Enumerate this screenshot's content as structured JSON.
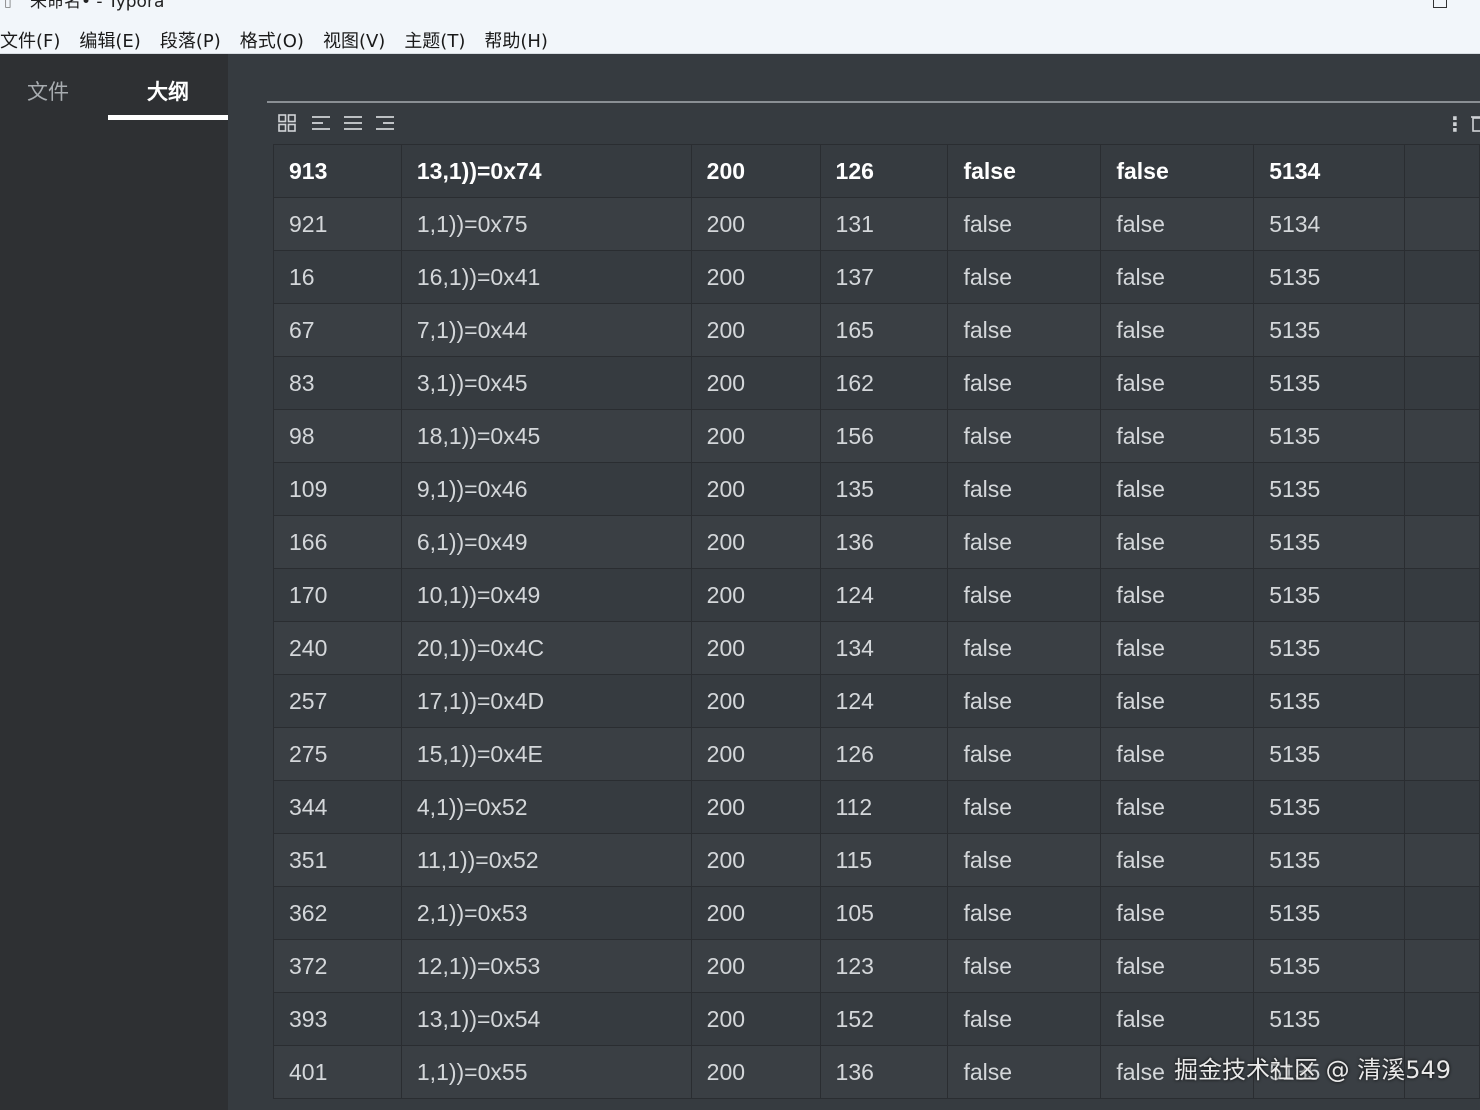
{
  "window": {
    "title": "未命名• - Typora"
  },
  "menu": [
    "文件(F)",
    "编辑(E)",
    "段落(P)",
    "格式(O)",
    "视图(V)",
    "主题(T)",
    "帮助(H)"
  ],
  "sidebar": {
    "tab_files": "文件",
    "tab_outline": "大纲",
    "active_tab": "大纲"
  },
  "table": {
    "header": [
      "913",
      "13,1))=0x74",
      "200",
      "126",
      "false",
      "false",
      "5134",
      ""
    ],
    "rows": [
      [
        "921",
        "1,1))=0x75",
        "200",
        "131",
        "false",
        "false",
        "5134",
        ""
      ],
      [
        "16",
        "16,1))=0x41",
        "200",
        "137",
        "false",
        "false",
        "5135",
        ""
      ],
      [
        "67",
        "7,1))=0x44",
        "200",
        "165",
        "false",
        "false",
        "5135",
        ""
      ],
      [
        "83",
        "3,1))=0x45",
        "200",
        "162",
        "false",
        "false",
        "5135",
        ""
      ],
      [
        "98",
        "18,1))=0x45",
        "200",
        "156",
        "false",
        "false",
        "5135",
        ""
      ],
      [
        "109",
        "9,1))=0x46",
        "200",
        "135",
        "false",
        "false",
        "5135",
        ""
      ],
      [
        "166",
        "6,1))=0x49",
        "200",
        "136",
        "false",
        "false",
        "5135",
        ""
      ],
      [
        "170",
        "10,1))=0x49",
        "200",
        "124",
        "false",
        "false",
        "5135",
        ""
      ],
      [
        "240",
        "20,1))=0x4C",
        "200",
        "134",
        "false",
        "false",
        "5135",
        ""
      ],
      [
        "257",
        "17,1))=0x4D",
        "200",
        "124",
        "false",
        "false",
        "5135",
        ""
      ],
      [
        "275",
        "15,1))=0x4E",
        "200",
        "126",
        "false",
        "false",
        "5135",
        ""
      ],
      [
        "344",
        "4,1))=0x52",
        "200",
        "112",
        "false",
        "false",
        "5135",
        ""
      ],
      [
        "351",
        "11,1))=0x52",
        "200",
        "115",
        "false",
        "false",
        "5135",
        ""
      ],
      [
        "362",
        "2,1))=0x53",
        "200",
        "105",
        "false",
        "false",
        "5135",
        ""
      ],
      [
        "372",
        "12,1))=0x53",
        "200",
        "123",
        "false",
        "false",
        "5135",
        ""
      ],
      [
        "393",
        "13,1))=0x54",
        "200",
        "152",
        "false",
        "false",
        "5135",
        ""
      ],
      [
        "401",
        "1,1))=0x55",
        "200",
        "136",
        "false",
        "false",
        "5135",
        ""
      ]
    ]
  },
  "watermark": "掘金技术社区 @ 清溪549"
}
